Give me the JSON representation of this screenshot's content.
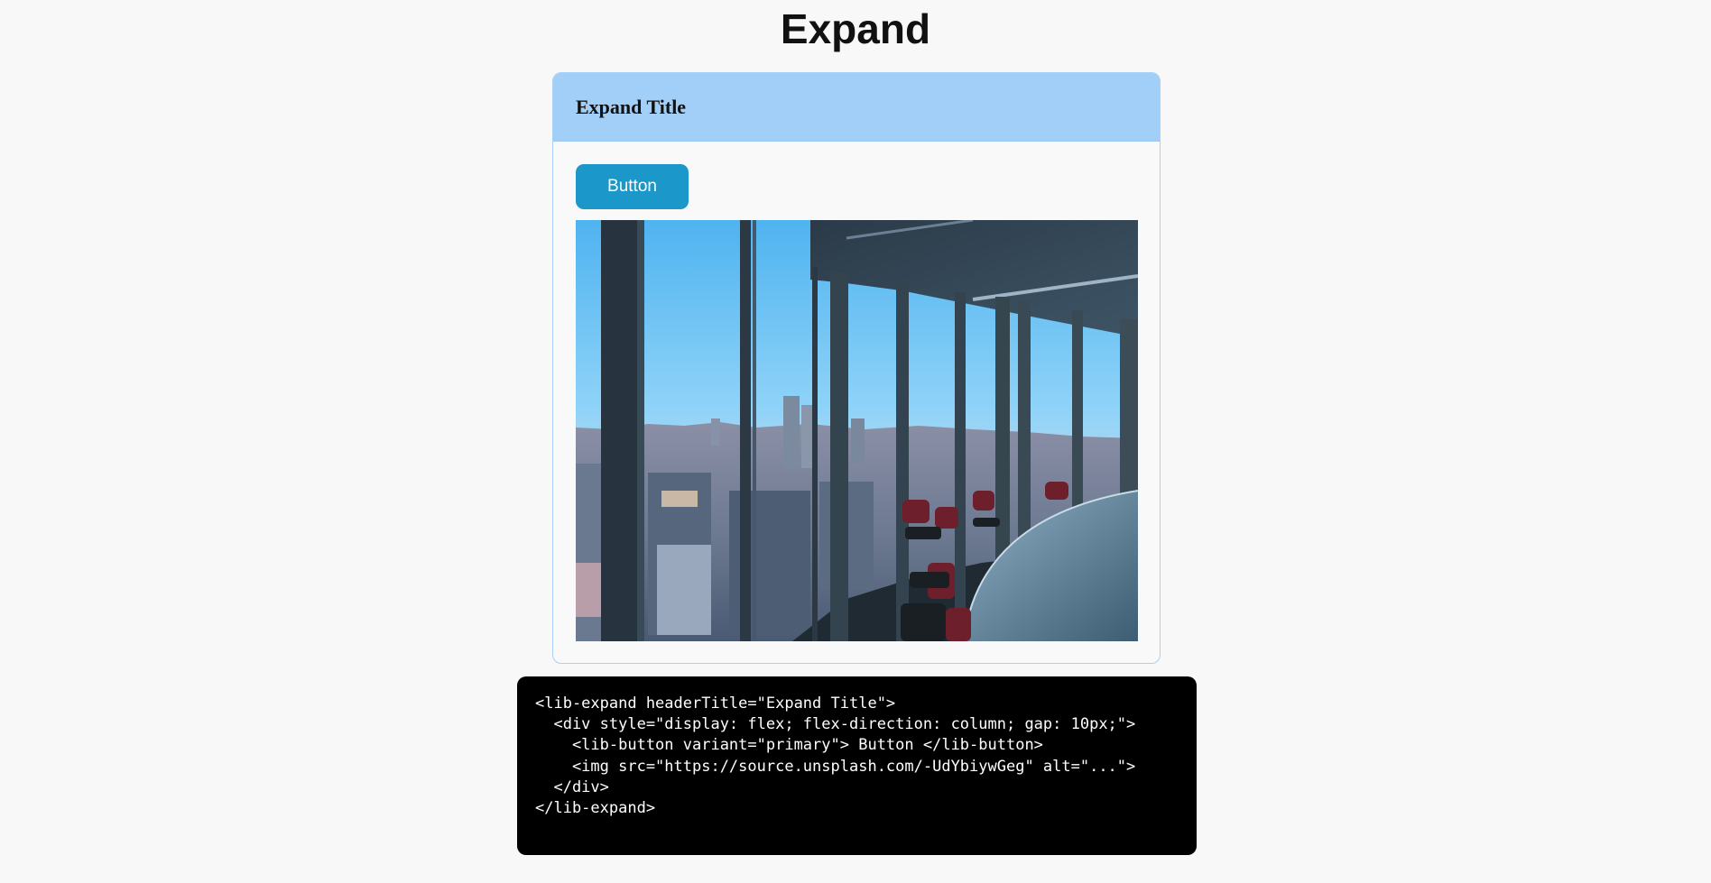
{
  "page": {
    "title": "Expand"
  },
  "expand": {
    "header_title": "Expand Title",
    "button_label": "Button",
    "image_alt": "...",
    "colors": {
      "header_bg": "#a2cff8",
      "border": "#a9d0f5",
      "button_bg": "#1c97c9"
    }
  },
  "code": {
    "lines": [
      "<lib-expand headerTitle=\"Expand Title\">",
      "  <div style=\"display: flex; flex-direction: column; gap: 10px;\">",
      "    <lib-button variant=\"primary\"> Button </lib-button>",
      "    <img src=\"https://source.unsplash.com/-UdYbiywGeg\" alt=\"...\">",
      "  </div>",
      "</lib-expand>"
    ]
  }
}
